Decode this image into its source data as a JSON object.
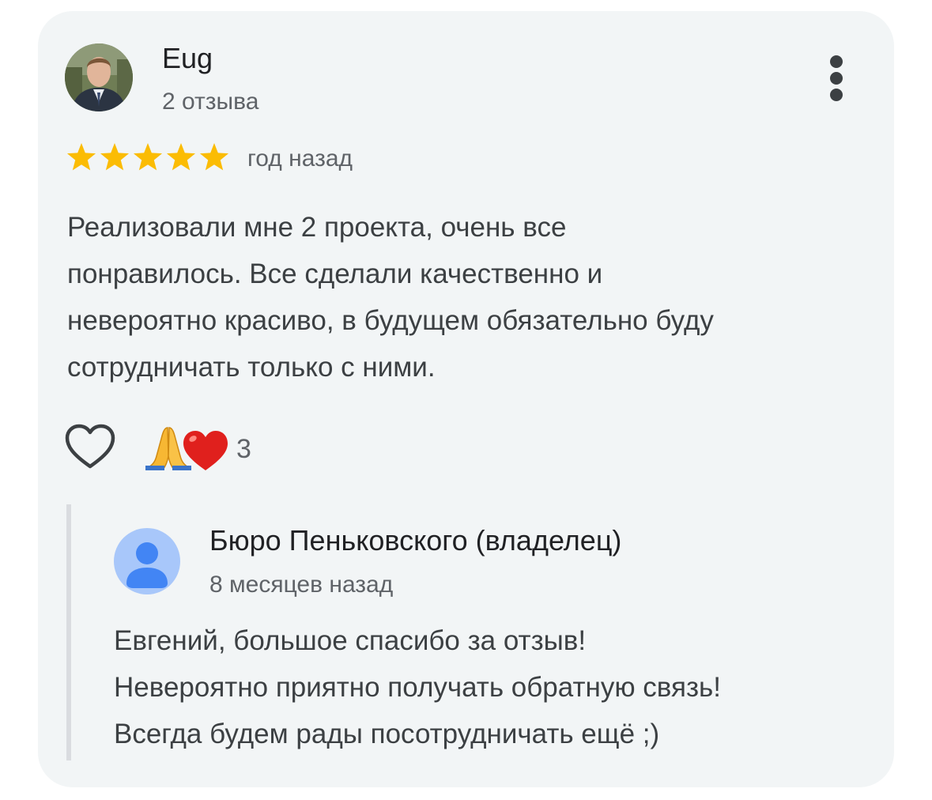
{
  "review": {
    "author_name": "Eug",
    "author_meta": "2 отзыва",
    "rating": 5,
    "rating_max": 5,
    "date": "год назад",
    "text": "Реализовали мне 2 проекта, очень все\nпонравилось. Все сделали качественно и\nневероятно красиво, в будущем обязательно буду\nсотрудничать только с ними.",
    "reactions": {
      "emojis": [
        "folded-hands-emoji",
        "red-heart-emoji"
      ],
      "count": "3"
    }
  },
  "owner_reply": {
    "name": "Бюро Пеньковского (владелец)",
    "date": "8 месяцев назад",
    "text": "Евгений, большое спасибо за отзыв!\nНевероятно приятно получать обратную связь!\nВсегда будем рады посотрудничать ещё ;)"
  },
  "colors": {
    "card_background": "#f2f5f6",
    "star": "#fbbc04",
    "owner_avatar": "#a8c7fa",
    "owner_avatar_figure": "#4285f4"
  }
}
